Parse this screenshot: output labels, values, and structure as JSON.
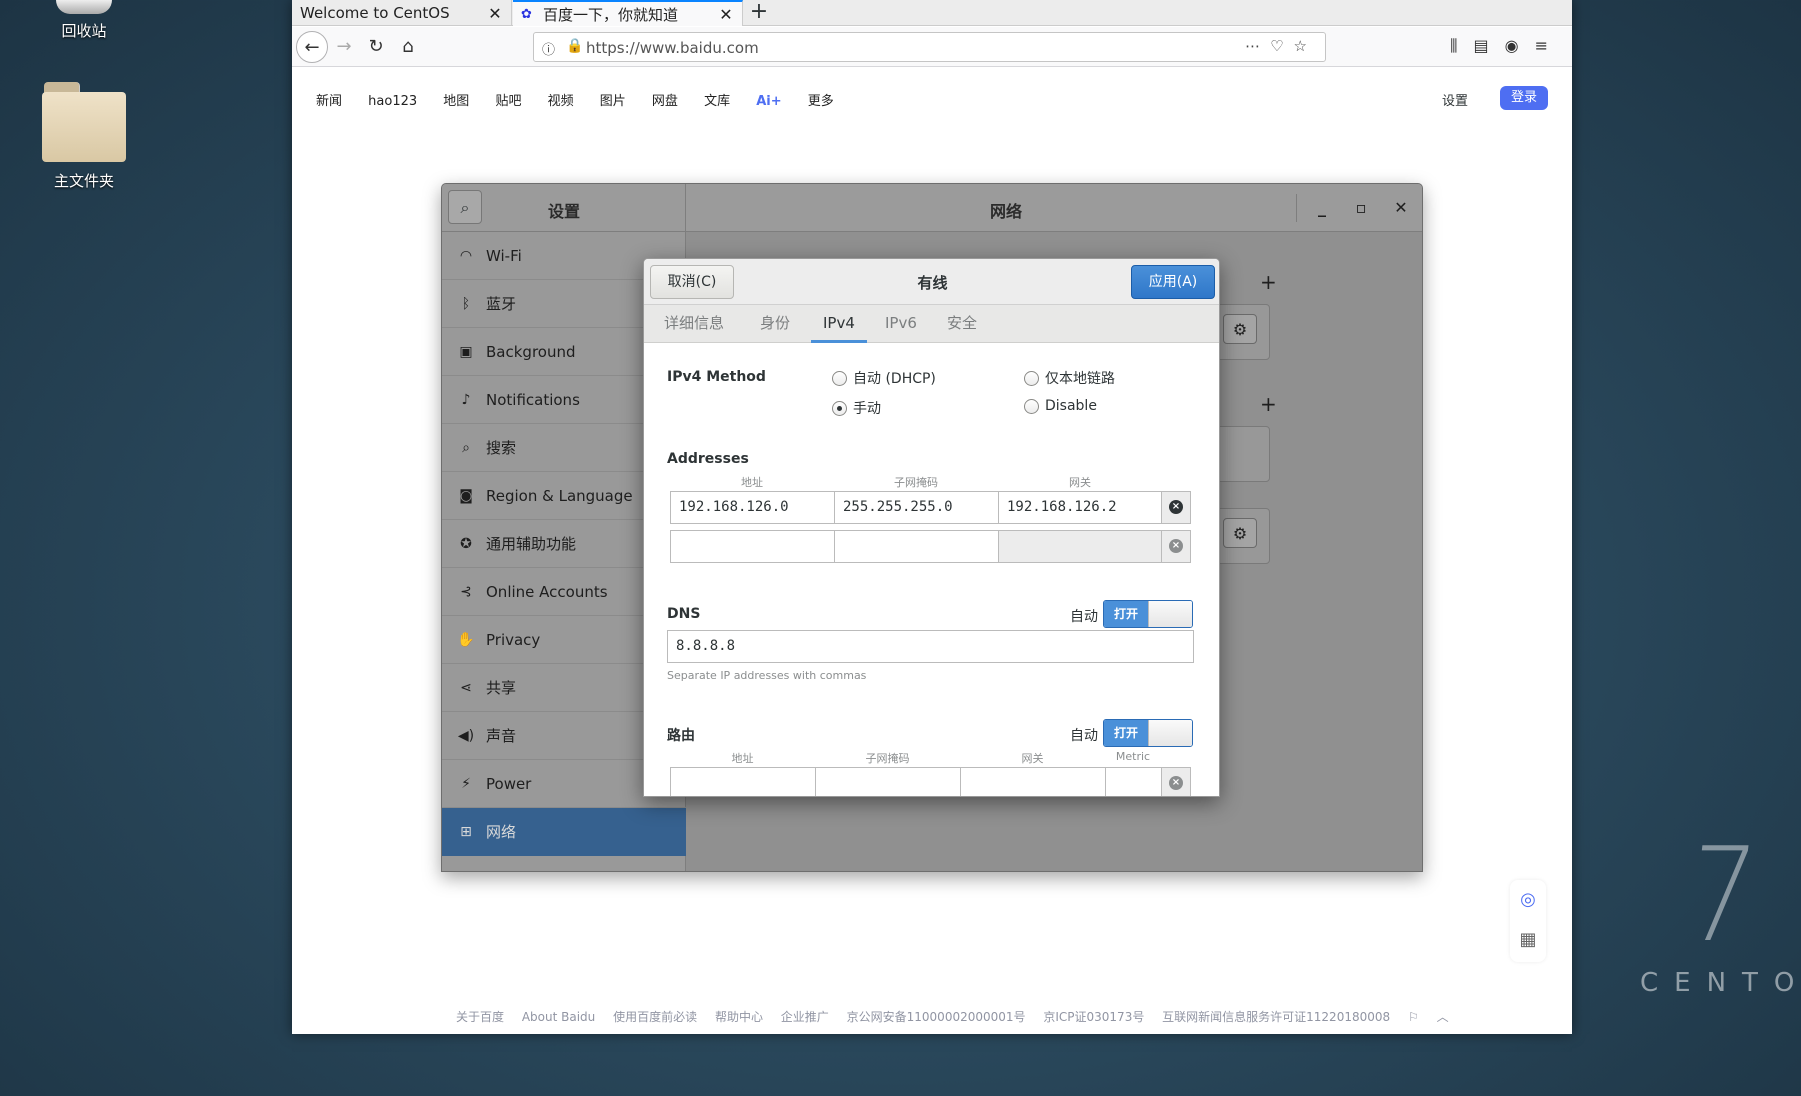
{
  "desktop": {
    "trash_label": "回收站",
    "home_label": "主文件夹",
    "brand_number": "7",
    "brand_text": "CENTOS"
  },
  "browser": {
    "tabs": [
      {
        "title": "Welcome to CentOS"
      },
      {
        "title": "百度一下，你就知道"
      }
    ],
    "url": "https://www.baidu.com"
  },
  "baidu": {
    "nav": [
      "新闻",
      "hao123",
      "地图",
      "贴吧",
      "视频",
      "图片",
      "网盘",
      "文库",
      "Ai+",
      "更多"
    ],
    "settings_label": "设置",
    "login_label": "登录",
    "footer": [
      "关于百度",
      "About Baidu",
      "使用百度前必读",
      "帮助中心",
      "企业推广",
      "京公网安备11000002000001号",
      "京ICP证030173号",
      "互联网新闻信息服务许可证11220180008"
    ]
  },
  "settings": {
    "sidebar_title": "设置",
    "page_title": "网络",
    "items": [
      {
        "label": "Wi-Fi",
        "icon": "wifi-icon"
      },
      {
        "label": "蓝牙",
        "icon": "bluetooth-icon"
      },
      {
        "label": "Background",
        "icon": "background-icon"
      },
      {
        "label": "Notifications",
        "icon": "bell-icon"
      },
      {
        "label": "搜索",
        "icon": "search-icon"
      },
      {
        "label": "Region & Language",
        "icon": "camera-icon"
      },
      {
        "label": "通用辅助功能",
        "icon": "accessibility-icon"
      },
      {
        "label": "Online Accounts",
        "icon": "online-accounts-icon"
      },
      {
        "label": "Privacy",
        "icon": "hand-icon"
      },
      {
        "label": "共享",
        "icon": "share-icon"
      },
      {
        "label": "声音",
        "icon": "speaker-icon"
      },
      {
        "label": "Power",
        "icon": "power-icon"
      },
      {
        "label": "网络",
        "icon": "network-icon",
        "active": true
      }
    ]
  },
  "dialog": {
    "cancel_label": "取消(C)",
    "title": "有线",
    "apply_label": "应用(A)",
    "tabs": [
      "详细信息",
      "身份",
      "IPv4",
      "IPv6",
      "安全"
    ],
    "active_tab": "IPv4",
    "ipv4_method_label": "IPv4 Method",
    "methods": [
      {
        "label": "自动 (DHCP)",
        "selected": false
      },
      {
        "label": "仅本地链路",
        "selected": false
      },
      {
        "label": "手动",
        "selected": true
      },
      {
        "label": "Disable",
        "selected": false
      }
    ],
    "addresses_label": "Addresses",
    "address_columns": [
      "地址",
      "子网掩码",
      "网关"
    ],
    "addresses": [
      {
        "address": "192.168.126.0",
        "netmask": "255.255.255.0",
        "gateway": "192.168.126.2"
      },
      {
        "address": "",
        "netmask": "",
        "gateway": ""
      }
    ],
    "dns_label": "DNS",
    "dns_auto_label": "自动",
    "dns_switch_label": "打开",
    "dns_value": "8.8.8.8",
    "dns_hint": "Separate IP addresses with commas",
    "routes_label": "路由",
    "routes_auto_label": "自动",
    "routes_switch_label": "打开",
    "route_columns": [
      "地址",
      "子网掩码",
      "网关",
      "Metric"
    ]
  }
}
